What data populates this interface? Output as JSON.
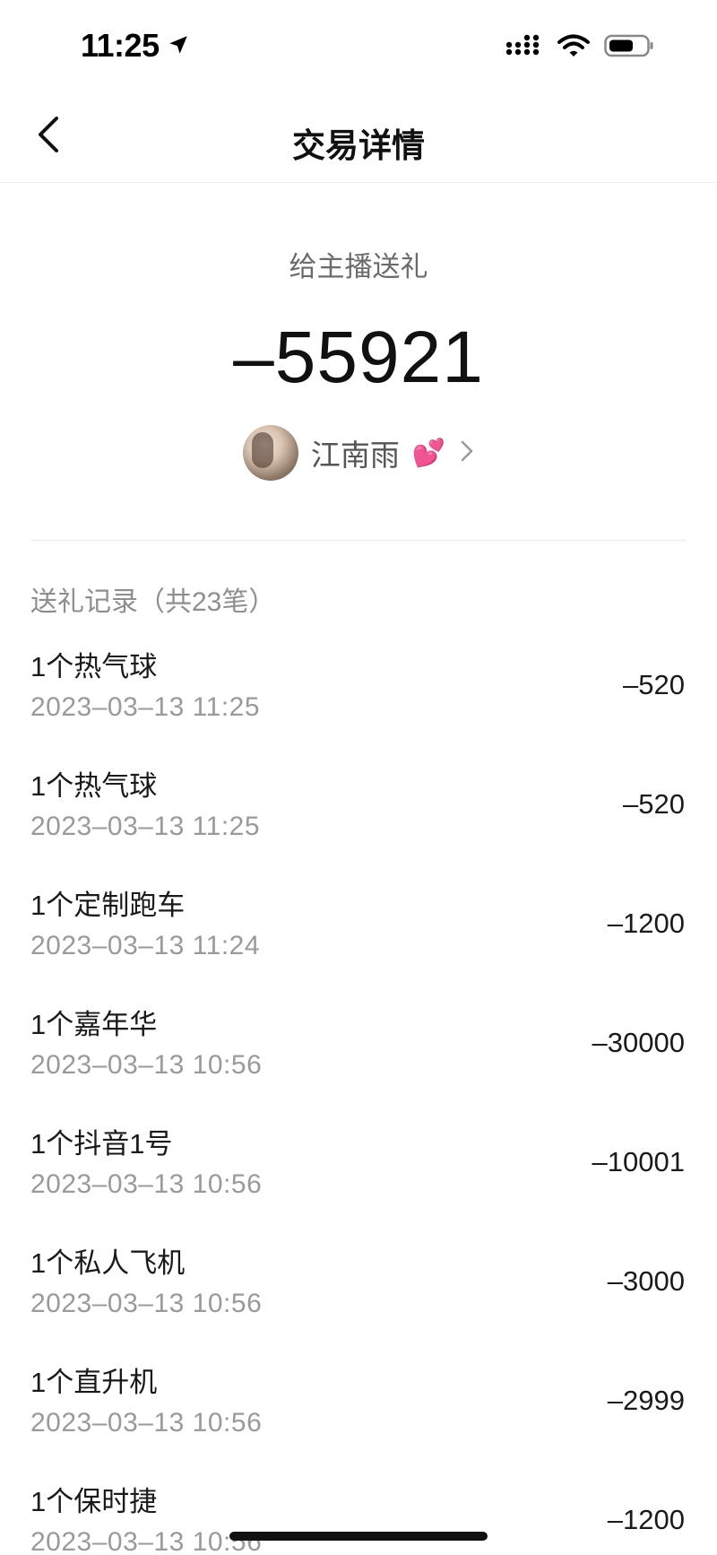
{
  "status_bar": {
    "time": "11:25",
    "icons": [
      "location-arrow-icon",
      "signal-icon",
      "wifi-icon",
      "battery-icon"
    ]
  },
  "nav": {
    "title": "交易详情",
    "back_icon": "chevron-left-icon"
  },
  "summary": {
    "label": "给主播送礼",
    "amount": "–55921",
    "anchor_name": "江南雨",
    "anchor_emoji": "💕"
  },
  "records": {
    "header": "送礼记录（共23笔）",
    "items": [
      {
        "name": "1个热气球",
        "time": "2023–03–13 11:25",
        "amount": "–520"
      },
      {
        "name": "1个热气球",
        "time": "2023–03–13 11:25",
        "amount": "–520"
      },
      {
        "name": "1个定制跑车",
        "time": "2023–03–13 11:24",
        "amount": "–1200"
      },
      {
        "name": "1个嘉年华",
        "time": "2023–03–13 10:56",
        "amount": "–30000"
      },
      {
        "name": "1个抖音1号",
        "time": "2023–03–13 10:56",
        "amount": "–10001"
      },
      {
        "name": "1个私人飞机",
        "time": "2023–03–13 10:56",
        "amount": "–3000"
      },
      {
        "name": "1个直升机",
        "time": "2023–03–13 10:56",
        "amount": "–2999"
      },
      {
        "name": "1个保时捷",
        "time": "2023–03–13 10:56",
        "amount": "–1200"
      }
    ]
  },
  "colors": {
    "text_primary": "#1a1a1a",
    "text_secondary": "#9a9a9a",
    "heart": "#ff4fa3"
  }
}
